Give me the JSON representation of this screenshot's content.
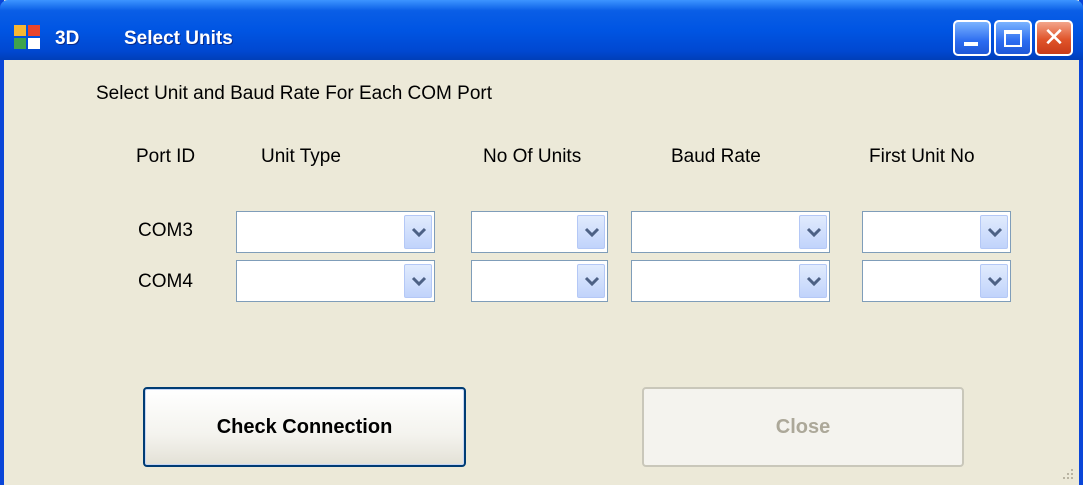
{
  "window": {
    "title_prefix": "3D",
    "title": "Select Units"
  },
  "heading": "Select Unit and Baud Rate For Each COM Port",
  "columns": {
    "port_id": "Port ID",
    "unit_type": "Unit Type",
    "no_of_units": "No Of Units",
    "baud_rate": "Baud Rate",
    "first_unit_no": "First Unit No"
  },
  "rows": [
    {
      "port": "COM3",
      "unit_type": "",
      "no_of_units": "",
      "baud_rate": "",
      "first_unit_no": ""
    },
    {
      "port": "COM4",
      "unit_type": "",
      "no_of_units": "",
      "baud_rate": "",
      "first_unit_no": ""
    }
  ],
  "buttons": {
    "check_connection": "Check Connection",
    "close": "Close"
  },
  "titlebar_icons": [
    "app-icon",
    "minimize-icon",
    "maximize-icon",
    "close-icon"
  ],
  "colors": {
    "titlebar": "#0055e3",
    "window_bg": "#ece9d8",
    "close_button": "#e0542a",
    "disabled_text": "#aca899"
  }
}
